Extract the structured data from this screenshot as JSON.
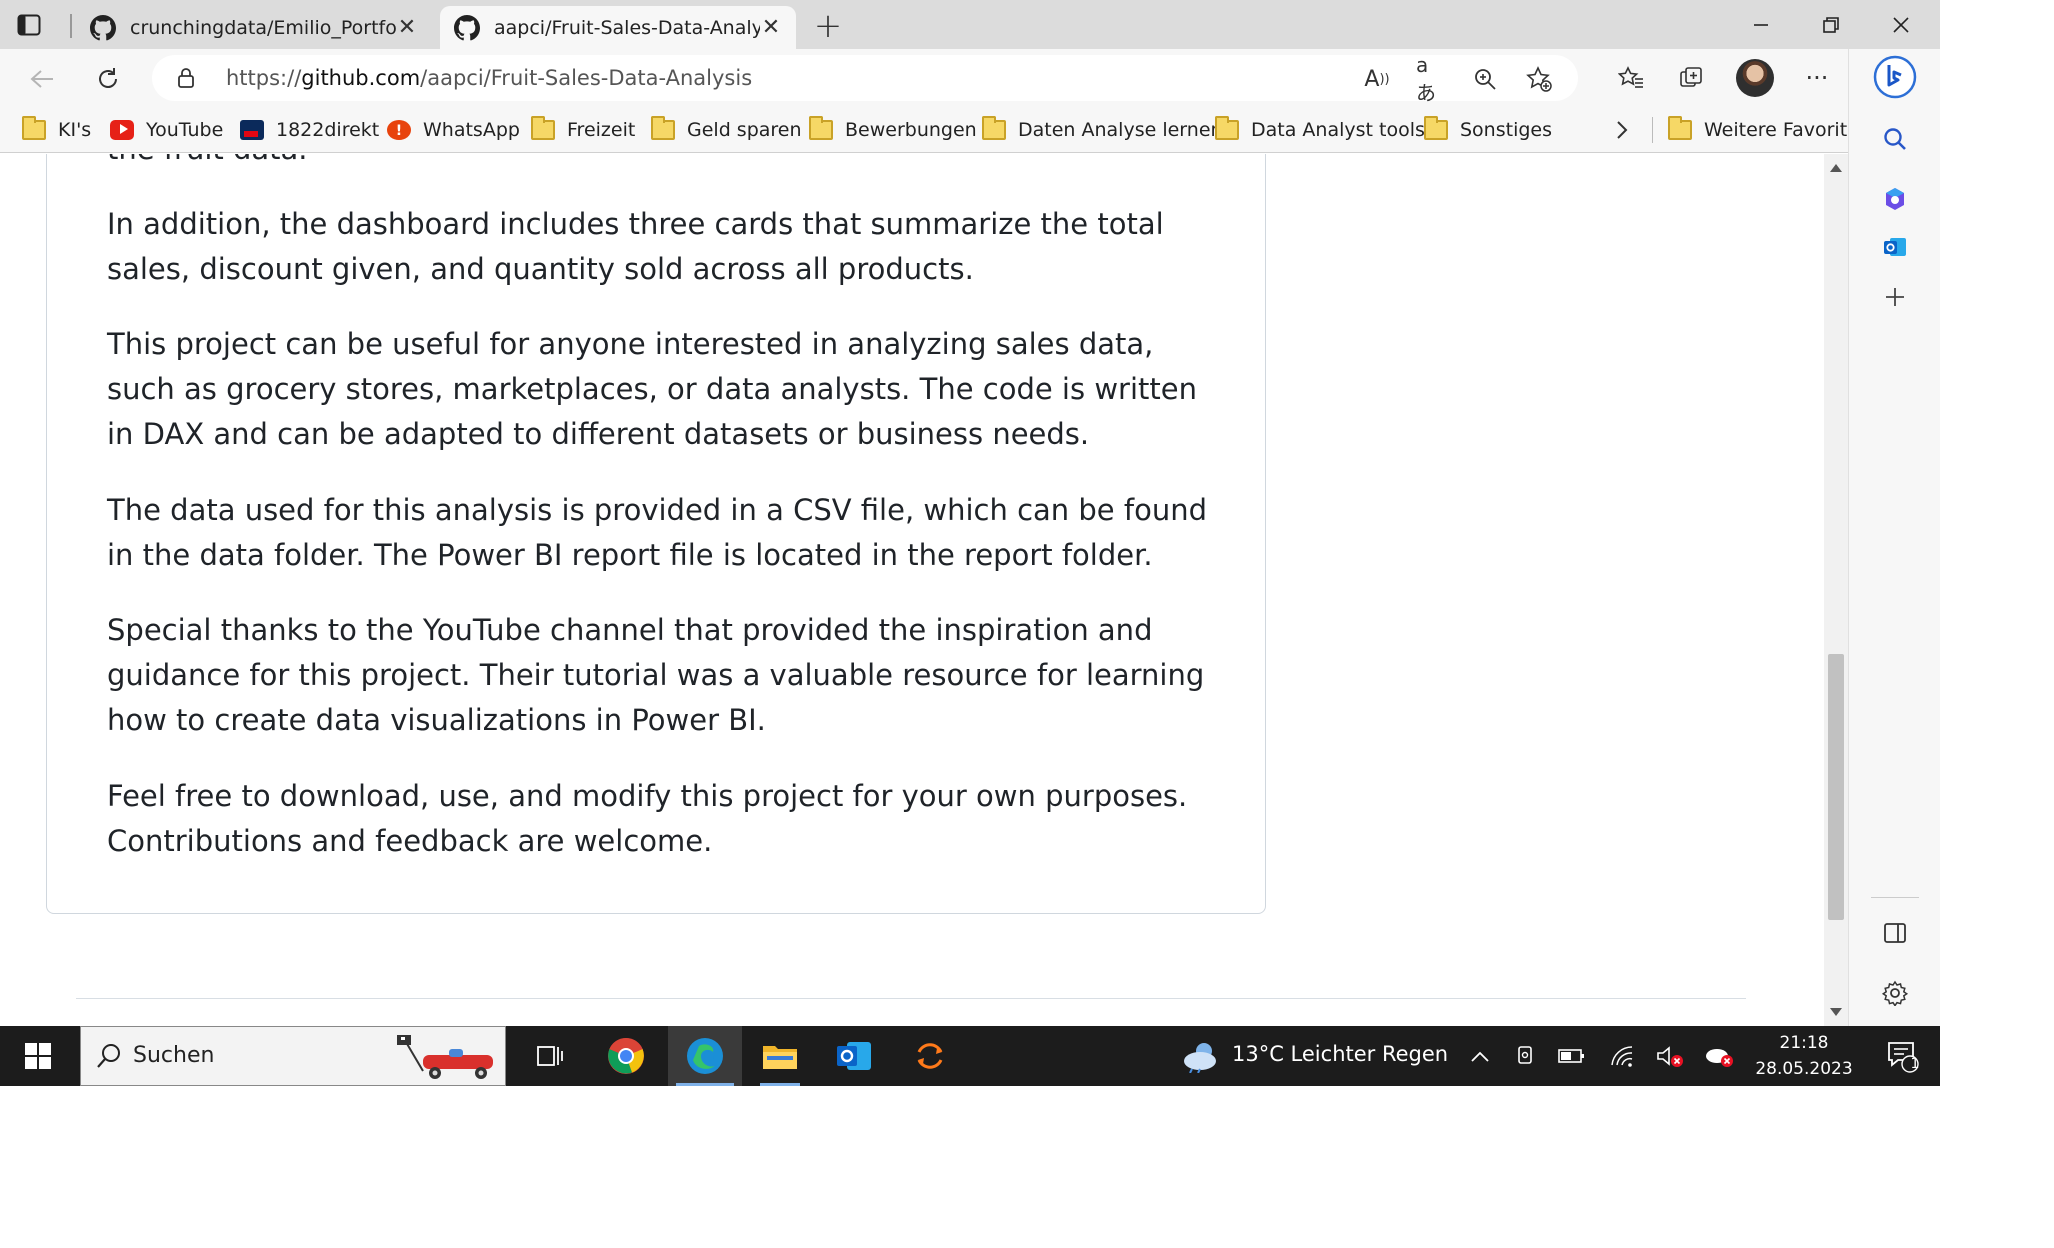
{
  "browser": {
    "tabs": [
      {
        "title": "crunchingdata/Emilio_Portfolio: c",
        "active": false
      },
      {
        "title": "aapci/Fruit-Sales-Data-Analysis: T",
        "active": true
      }
    ],
    "url_prefix": "https://",
    "url_host": "github.com",
    "url_path": "/aapci/Fruit-Sales-Data-Analysis",
    "bookmarks": [
      {
        "label": "KI's",
        "icon": "folder-icon"
      },
      {
        "label": "YouTube",
        "icon": "youtube-icon"
      },
      {
        "label": "1822direkt",
        "icon": "bank-icon"
      },
      {
        "label": "WhatsApp",
        "icon": "whatsapp-icon"
      },
      {
        "label": "Freizeit",
        "icon": "folder-icon"
      },
      {
        "label": "Geld sparen",
        "icon": "folder-icon"
      },
      {
        "label": "Bewerbungen",
        "icon": "folder-icon"
      },
      {
        "label": "Daten Analyse lernen",
        "icon": "folder-icon"
      },
      {
        "label": "Data Analyst tools",
        "icon": "folder-icon"
      },
      {
        "label": "Sonstiges",
        "icon": "folder-icon"
      }
    ],
    "more_favorites": "Weitere Favoriten"
  },
  "readme": {
    "cut_line": "the fruit data.",
    "paragraphs": [
      "In addition, the dashboard includes three cards that summarize the total sales, discount given, and quantity sold across all products.",
      "This project can be useful for anyone interested in analyzing sales data, such as grocery stores, marketplaces, or data analysts. The code is written in DAX and can be adapted to different datasets or business needs.",
      "The data used for this analysis is provided in a CSV file, which can be found in the data folder. The Power BI report file is located in the report folder.",
      "Special thanks to the YouTube channel that provided the inspiration and guidance for this project. Their tutorial was a valuable resource for learning how to create data visualizations in Power BI.",
      "Feel free to download, use, and modify this project for your own purposes. Contributions and feedback are welcome."
    ]
  },
  "taskbar": {
    "search_label": "Suchen",
    "weather": "13°C  Leichter Regen",
    "time": "21:18",
    "date": "28.05.2023",
    "notification_count": "1"
  },
  "colors": {
    "tabstrip": "#dcdcdc",
    "toolbar": "#f7f7f7",
    "taskbar": "#1c1c1c",
    "text": "#1f2328"
  }
}
